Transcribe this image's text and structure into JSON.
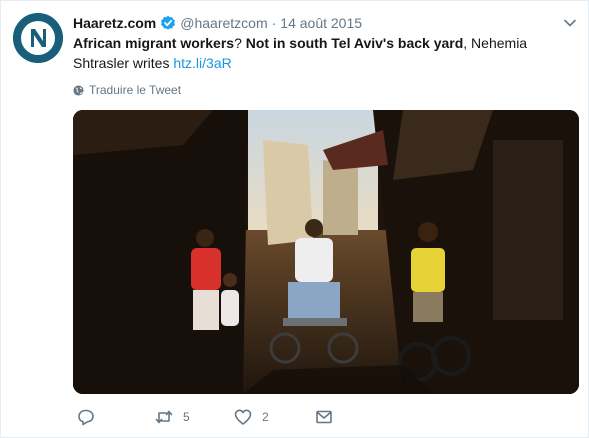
{
  "tweet": {
    "author_name": "Haaretz.com",
    "handle": "@haaretzcom",
    "separator": "·",
    "date": "14 août 2015",
    "text_bold_1": "African migrant workers",
    "text_q": "?",
    "text_bold_2": "Not in south Tel Aviv's back yard",
    "text_tail": ", Nehemia Shtrasler writes",
    "link_text": "htz.li/3aR",
    "translate_label": "Traduire le Tweet"
  },
  "actions": {
    "reply_count": "",
    "retweet_count": "5",
    "like_count": "2"
  },
  "icons": {
    "avatar": "haaretz-logo",
    "verified": "verified-badge-icon",
    "menu": "chevron-down-icon",
    "translate": "globe-icon",
    "reply": "reply-icon",
    "retweet": "retweet-icon",
    "like": "heart-icon",
    "dm": "envelope-icon"
  },
  "colors": {
    "accent": "#1b95e0",
    "muted": "#657786",
    "text": "#14171a",
    "avatar_bg": "#1a5f7a"
  }
}
